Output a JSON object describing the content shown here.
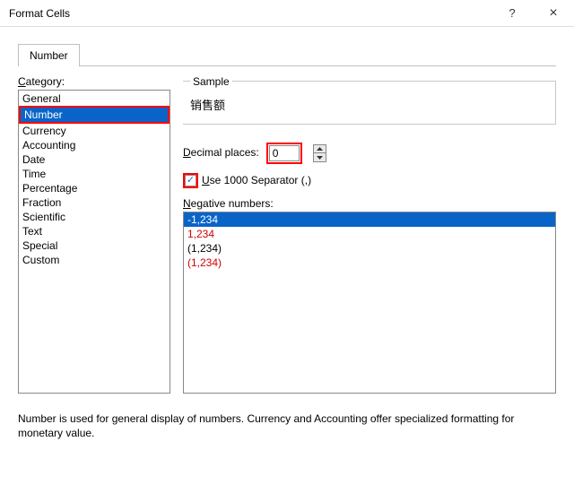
{
  "window": {
    "title": "Format Cells",
    "help": "?",
    "close": "×"
  },
  "tabs": [
    {
      "label": "Number"
    }
  ],
  "category": {
    "label_pre": "C",
    "label_rest": "ategory:",
    "items": [
      "General",
      "Number",
      "Currency",
      "Accounting",
      "Date",
      "Time",
      "Percentage",
      "Fraction",
      "Scientific",
      "Text",
      "Special",
      "Custom"
    ],
    "selected_index": 1
  },
  "sample": {
    "legend": "Sample",
    "value": "销售额"
  },
  "decimal": {
    "label_pre": "D",
    "label_rest": "ecimal places:",
    "value": "0"
  },
  "separator": {
    "label_pre": "U",
    "label_rest": "se 1000 Separator (,)",
    "checked": true
  },
  "negative": {
    "label_pre": "N",
    "label_rest": "egative numbers:",
    "items": [
      {
        "text": "-1,234",
        "selected": true,
        "red": false
      },
      {
        "text": "1,234",
        "selected": false,
        "red": true
      },
      {
        "text": "(1,234)",
        "selected": false,
        "red": false
      },
      {
        "text": "(1,234)",
        "selected": false,
        "red": true
      }
    ]
  },
  "description": "Number is used for general display of numbers.  Currency and Accounting offer specialized formatting for monetary value."
}
